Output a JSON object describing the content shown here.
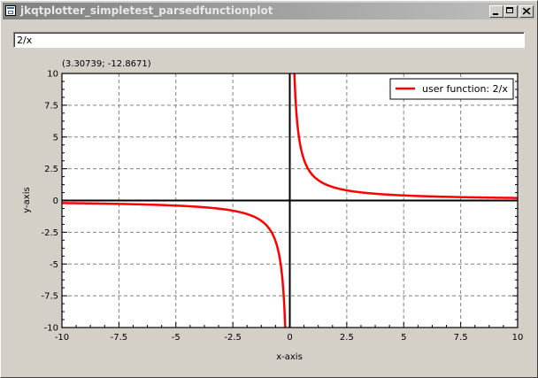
{
  "window": {
    "title": "jkqtplotter_simpletest_parsedfunctionplot",
    "icon": "app-window-icon",
    "buttons": [
      "minimize-icon",
      "maximize-icon",
      "close-icon"
    ]
  },
  "function_input": {
    "value": "2/x"
  },
  "plot": {
    "coordinate_readout": "(3.30739; -12.8671)",
    "colors": {
      "curve": "#ff0000",
      "grid": "#808080",
      "axis": "#000000"
    }
  },
  "chart_data": {
    "type": "line",
    "xlabel": "x-axis",
    "ylabel": "y-axis",
    "xlim": [
      -10,
      10
    ],
    "ylim": [
      -10,
      10
    ],
    "x_ticks": [
      -10,
      -7.5,
      -5,
      -2.5,
      0,
      2.5,
      5,
      7.5,
      10
    ],
    "y_ticks": [
      -10,
      -7.5,
      -5,
      -2.5,
      0,
      2.5,
      5,
      7.5,
      10
    ],
    "x_tick_labels": [
      "-10",
      "-7.5",
      "-5",
      "-2.5",
      "0",
      "2.5",
      "5",
      "7.5",
      "10"
    ],
    "y_tick_labels": [
      "-10",
      "-7.5",
      "-5",
      "-2.5",
      "0",
      "2.5",
      "5",
      "7.5",
      "10"
    ],
    "grid": true,
    "legend": {
      "placement": "top-right"
    },
    "series": [
      {
        "name": "user function: 2/x",
        "color": "#ff0000",
        "x": [
          -10,
          -8,
          -6,
          -5,
          -4,
          -3,
          -2.5,
          -2,
          -1.5,
          -1,
          -0.8,
          -0.6,
          -0.5,
          -0.4,
          -0.3,
          -0.25,
          -0.2,
          null,
          0.2,
          0.25,
          0.3,
          0.4,
          0.5,
          0.6,
          0.8,
          1,
          1.5,
          2,
          2.5,
          3,
          4,
          5,
          6,
          8,
          10
        ],
        "y": [
          -0.2,
          -0.25,
          -0.333,
          -0.4,
          -0.5,
          -0.667,
          -0.8,
          -1,
          -1.333,
          -2,
          -2.5,
          -3.333,
          -4,
          -5,
          -6.667,
          -8,
          -10,
          null,
          10,
          8,
          6.667,
          5,
          4,
          3.333,
          2.5,
          2,
          1.333,
          1,
          0.8,
          0.667,
          0.5,
          0.4,
          0.333,
          0.25,
          0.2
        ]
      }
    ]
  }
}
